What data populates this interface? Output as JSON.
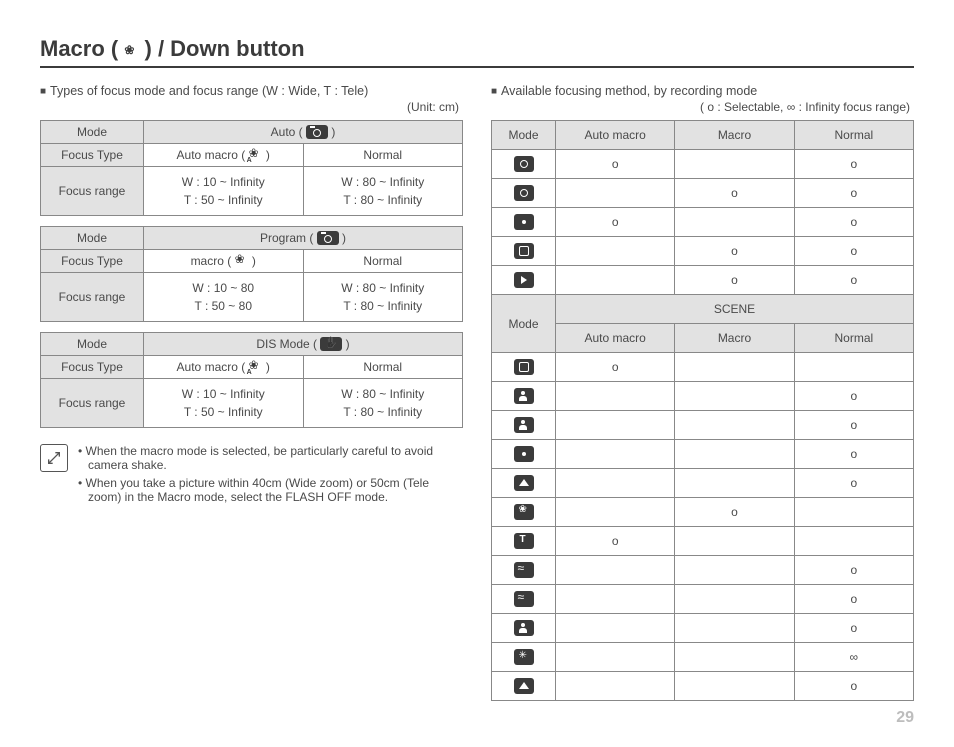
{
  "page": {
    "title_prefix": "Macro (",
    "title_suffix": ") / Down button",
    "number": "29"
  },
  "left": {
    "heading": "Types of focus mode and focus range (W : Wide, T : Tele)",
    "unit": "(Unit: cm)",
    "labels": {
      "mode": "Mode",
      "focus_type": "Focus Type",
      "focus_range": "Focus range"
    },
    "tables": [
      {
        "mode_label": "Auto (",
        "type_a": "Auto macro (",
        "type_b": "Normal",
        "range_a_w": "W : 10 ~ Infinity",
        "range_a_t": "T  : 50 ~ Infinity",
        "range_b_w": "W : 80 ~ Infinity",
        "range_b_t": "T  : 80 ~ Infinity"
      },
      {
        "mode_label": "Program (",
        "type_a": "macro (",
        "type_b": "Normal",
        "range_a_w": "W : 10 ~ 80",
        "range_a_t": "T  : 50 ~ 80",
        "range_b_w": "W : 80 ~ Infinity",
        "range_b_t": "T  : 80 ~ Infinity"
      },
      {
        "mode_label": "DIS Mode (",
        "type_a": "Auto macro (",
        "type_b": "Normal",
        "range_a_w": "W : 10 ~ Infinity",
        "range_a_t": "T  : 50 ~ Infinity",
        "range_b_w": "W : 80 ~ Infinity",
        "range_b_t": "T  : 80 ~ Infinity"
      }
    ],
    "notes": [
      "When the macro mode is selected, be particularly careful to avoid camera shake.",
      "When you take a picture within 40cm (Wide zoom) or 50cm (Tele zoom) in the Macro mode, select the FLASH OFF mode."
    ]
  },
  "right": {
    "heading": "Available focusing method, by recording mode",
    "legend": "( o : Selectable, ∞ : Infinity focus range)",
    "headers": {
      "mode": "Mode",
      "auto_macro": "Auto macro",
      "macro": "Macro",
      "normal": "Normal",
      "scene": "SCENE"
    },
    "top_rows": [
      {
        "icon": "auto",
        "am": "o",
        "m": "",
        "n": "o"
      },
      {
        "icon": "program",
        "am": "",
        "m": "o",
        "n": "o"
      },
      {
        "icon": "dis",
        "am": "o",
        "m": "",
        "n": "o"
      },
      {
        "icon": "dual",
        "am": "",
        "m": "o",
        "n": "o"
      },
      {
        "icon": "movie",
        "am": "",
        "m": "o",
        "n": "o"
      }
    ],
    "scene_rows": [
      {
        "icon": "guide",
        "am": "o",
        "m": "",
        "n": ""
      },
      {
        "icon": "portrait",
        "am": "",
        "m": "",
        "n": "o"
      },
      {
        "icon": "children",
        "am": "",
        "m": "",
        "n": "o"
      },
      {
        "icon": "night",
        "am": "",
        "m": "",
        "n": "o"
      },
      {
        "icon": "landscape",
        "am": "",
        "m": "",
        "n": "o"
      },
      {
        "icon": "closeup",
        "am": "",
        "m": "o",
        "n": ""
      },
      {
        "icon": "text",
        "am": "o",
        "m": "",
        "n": ""
      },
      {
        "icon": "sunset",
        "am": "",
        "m": "",
        "n": "o"
      },
      {
        "icon": "dawn",
        "am": "",
        "m": "",
        "n": "o"
      },
      {
        "icon": "backlight",
        "am": "",
        "m": "",
        "n": "o"
      },
      {
        "icon": "firework",
        "am": "",
        "m": "",
        "n": "∞"
      },
      {
        "icon": "beach",
        "am": "",
        "m": "",
        "n": "o"
      }
    ]
  }
}
